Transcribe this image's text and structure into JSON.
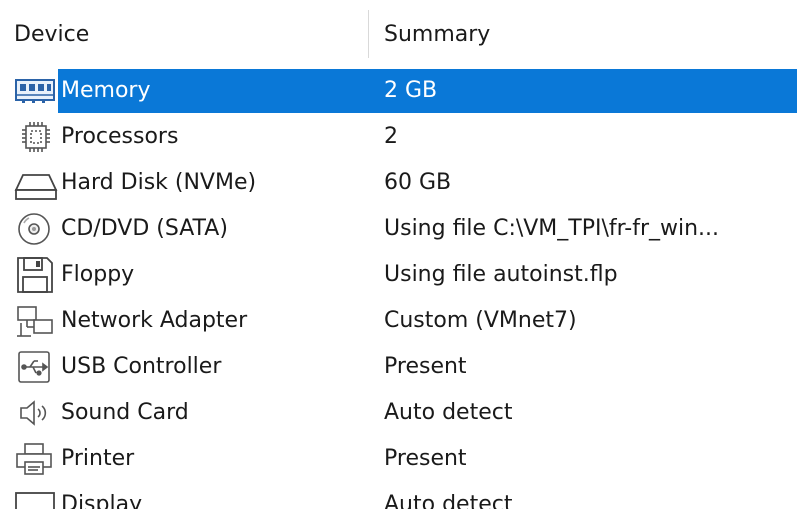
{
  "columns": {
    "device": "Device",
    "summary": "Summary"
  },
  "colors": {
    "selection": "#0a78d7",
    "text": "#1a1a1a",
    "selected_text": "#ffffff"
  },
  "devices": [
    {
      "icon": "memory-icon",
      "name": "Memory",
      "summary": "2 GB",
      "selected": true
    },
    {
      "icon": "processor-icon",
      "name": "Processors",
      "summary": "2",
      "selected": false
    },
    {
      "icon": "hard-disk-icon",
      "name": "Hard Disk (NVMe)",
      "summary": "60 GB",
      "selected": false
    },
    {
      "icon": "cd-dvd-icon",
      "name": "CD/DVD (SATA)",
      "summary": "Using file C:\\VM_TPI\\fr-fr_win...",
      "selected": false
    },
    {
      "icon": "floppy-icon",
      "name": "Floppy",
      "summary": "Using file autoinst.flp",
      "selected": false
    },
    {
      "icon": "network-adapter-icon",
      "name": "Network Adapter",
      "summary": "Custom (VMnet7)",
      "selected": false
    },
    {
      "icon": "usb-icon",
      "name": "USB Controller",
      "summary": "Present",
      "selected": false
    },
    {
      "icon": "speaker-icon",
      "name": "Sound Card",
      "summary": "Auto detect",
      "selected": false
    },
    {
      "icon": "printer-icon",
      "name": "Printer",
      "summary": "Present",
      "selected": false
    },
    {
      "icon": "display-icon",
      "name": "Display",
      "summary": "Auto detect",
      "selected": false
    }
  ]
}
